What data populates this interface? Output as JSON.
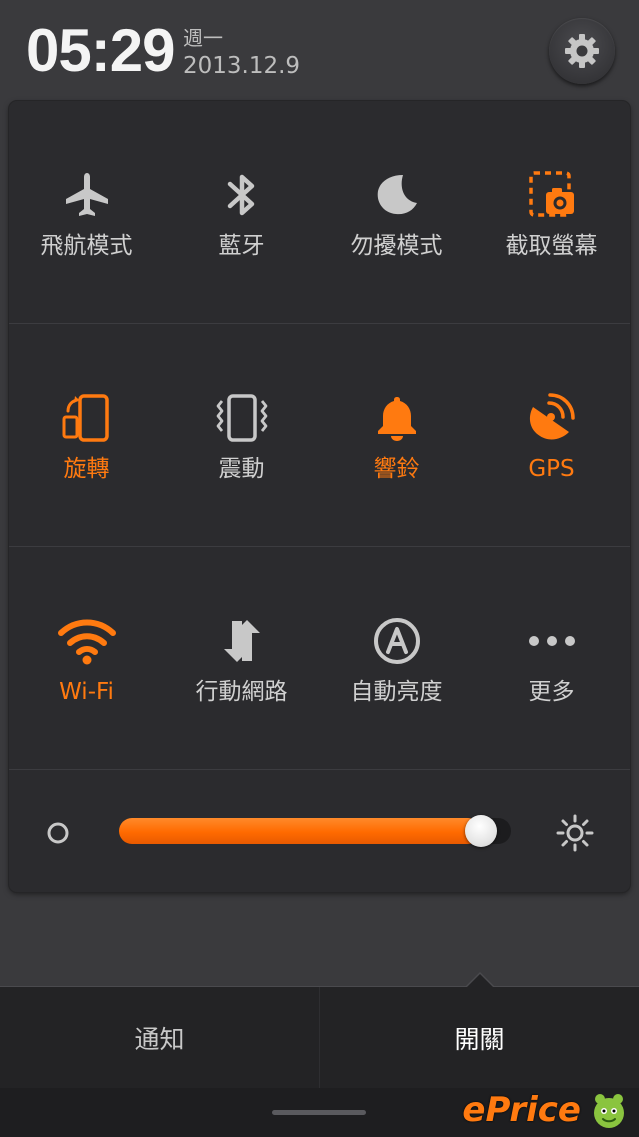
{
  "status": {
    "time": "05:29",
    "weekday": "週一",
    "date": "2013.12.9"
  },
  "toggles": {
    "airplane": {
      "label": "飛航模式",
      "state": "off"
    },
    "bluetooth": {
      "label": "藍牙",
      "state": "off"
    },
    "do_not_disturb": {
      "label": "勿擾模式",
      "state": "off"
    },
    "screenshot": {
      "label": "截取螢幕",
      "state": "on"
    },
    "rotation": {
      "label": "旋轉",
      "state": "on"
    },
    "vibrate": {
      "label": "震動",
      "state": "off"
    },
    "ringer": {
      "label": "響鈴",
      "state": "on"
    },
    "gps": {
      "label": "GPS",
      "state": "on"
    },
    "wifi": {
      "label": "Wi-Fi",
      "state": "on"
    },
    "mobile_data": {
      "label": "行動網路",
      "state": "off"
    },
    "auto_brightness": {
      "label": "自動亮度",
      "state": "off"
    },
    "more": {
      "label": "更多",
      "state": "off"
    }
  },
  "brightness": {
    "level": 0.96
  },
  "tabs": {
    "notifications": "通知",
    "toggles": "開關"
  },
  "watermark": {
    "text": "ePrice"
  },
  "colors": {
    "accent": "#ff7a10",
    "icon_off": "#c8c8c8",
    "panel_bg": "#2b2b2e"
  }
}
